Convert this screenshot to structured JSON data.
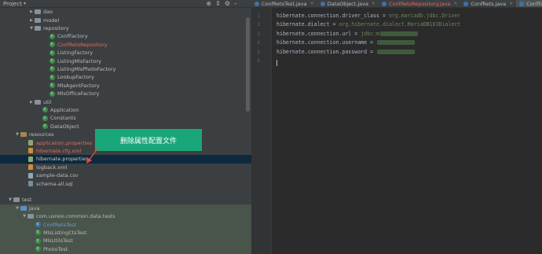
{
  "project_panel": {
    "title": "Project",
    "dropdown": "▾",
    "icons": [
      "crosshair-icon",
      "collapse-icon",
      "settings-icon",
      "hide-icon"
    ]
  },
  "tree": [
    {
      "label": "dao",
      "kind": "folder",
      "indent": 4,
      "arrow": "right",
      "color": "plain"
    },
    {
      "label": "model",
      "kind": "folder",
      "indent": 4,
      "arrow": "right",
      "color": "plain"
    },
    {
      "label": "repository",
      "kind": "folder",
      "indent": 4,
      "arrow": "down",
      "color": "plain"
    },
    {
      "label": "ConfFactory",
      "kind": "class",
      "indent": 6,
      "color": "plain"
    },
    {
      "label": "ConfRetsRepository",
      "kind": "class",
      "indent": 6,
      "color": "red"
    },
    {
      "label": "ListingFactory",
      "kind": "class",
      "indent": 6,
      "color": "plain"
    },
    {
      "label": "ListingMlsFactory",
      "kind": "class",
      "indent": 6,
      "color": "plain"
    },
    {
      "label": "ListingMlsPhotoFactory",
      "kind": "class",
      "indent": 6,
      "color": "plain"
    },
    {
      "label": "LookupFactory",
      "kind": "class",
      "indent": 6,
      "color": "plain"
    },
    {
      "label": "MlsAgentFactory",
      "kind": "class",
      "indent": 6,
      "color": "plain"
    },
    {
      "label": "MlsOfficeFactory",
      "kind": "class",
      "indent": 6,
      "color": "plain"
    },
    {
      "label": "util",
      "kind": "folder",
      "indent": 4,
      "arrow": "right",
      "color": "plain"
    },
    {
      "label": "Application",
      "kind": "class",
      "indent": 5,
      "color": "plain"
    },
    {
      "label": "Constants",
      "kind": "class",
      "indent": 5,
      "color": "plain"
    },
    {
      "label": "DataObject",
      "kind": "class",
      "indent": 5,
      "color": "plain"
    },
    {
      "label": "resources",
      "kind": "res",
      "indent": 2,
      "arrow": "down",
      "color": "plain"
    },
    {
      "label": "application.properties",
      "kind": "props",
      "indent": 3,
      "color": "red"
    },
    {
      "label": "hibernate.cfg.xml",
      "kind": "xml",
      "indent": 3,
      "color": "red"
    },
    {
      "label": "hibernate.properties",
      "kind": "props",
      "indent": 3,
      "color": "light",
      "selected": true
    },
    {
      "label": "logback.xml",
      "kind": "xml",
      "indent": 3,
      "color": "plain"
    },
    {
      "label": "sample-data.csv",
      "kind": "csv",
      "indent": 3,
      "color": "plain"
    },
    {
      "label": "schema-all.sql",
      "kind": "sql",
      "indent": 3,
      "color": "plain"
    },
    {
      "label": "",
      "kind": "blank",
      "indent": 0,
      "color": "plain"
    },
    {
      "label": "test",
      "kind": "folder",
      "indent": 1,
      "arrow": "down",
      "color": "plain"
    },
    {
      "label": "java",
      "kind": "src",
      "indent": 2,
      "arrow": "down",
      "color": "plain",
      "green": true
    },
    {
      "label": "com.usreio.common.data.tests",
      "kind": "pkg",
      "indent": 3,
      "arrow": "down",
      "color": "plain",
      "green": true
    },
    {
      "label": "ConfRetsTest",
      "kind": "class",
      "indent": 4,
      "color": "blue",
      "green": true
    },
    {
      "label": "MlsListingCtsTest",
      "kind": "class",
      "indent": 4,
      "color": "plain",
      "green": true
    },
    {
      "label": "MlsUtilsTest",
      "kind": "class",
      "indent": 4,
      "color": "plain",
      "green": true
    },
    {
      "label": "PhotoTest",
      "kind": "class",
      "indent": 4,
      "color": "plain",
      "green": true
    },
    {
      "label": "VariableTest",
      "kind": "class",
      "indent": 4,
      "color": "plain",
      "green": true
    }
  ],
  "callout": {
    "text": "删除属性配置文件"
  },
  "tabs": [
    {
      "label": "ConfRetsTest.java",
      "color": "plain",
      "active": false
    },
    {
      "label": "DataObject.java",
      "color": "plain",
      "active": false
    },
    {
      "label": "ConfRetsRepository.java",
      "color": "red",
      "active": false
    },
    {
      "label": "ConfRets.java",
      "color": "plain",
      "active": false
    },
    {
      "label": "ConfFactory.java",
      "color": "plain",
      "active": true
    }
  ],
  "editor": {
    "lines": [
      {
        "num": "1",
        "key": "hibernate.connection.driver_class",
        "value": "org.mariadb.jdbc.Driver",
        "blurred": false
      },
      {
        "num": "2",
        "key": "hibernate.dialect",
        "value": "org.hibernate.dialect.MariaDB103Dialect",
        "blurred": false
      },
      {
        "num": "3",
        "key": "hibernate.connection.url",
        "value": "jdbc:m",
        "blurred": true
      },
      {
        "num": "4",
        "key": "hibernate.connection.username",
        "value": "",
        "blurred": true
      },
      {
        "num": "5",
        "key": "hibernate.connection.password",
        "value": "",
        "blurred": true
      },
      {
        "num": "6",
        "key": "",
        "value": "",
        "blurred": false
      }
    ]
  },
  "colors": {
    "panel_bg": "#3c3f41",
    "editor_bg": "#2b2b2b",
    "callout_bg": "#1aa67b",
    "red_text": "#e36a5a",
    "green_row": "#49544a",
    "selected_row": "#0d293e"
  }
}
